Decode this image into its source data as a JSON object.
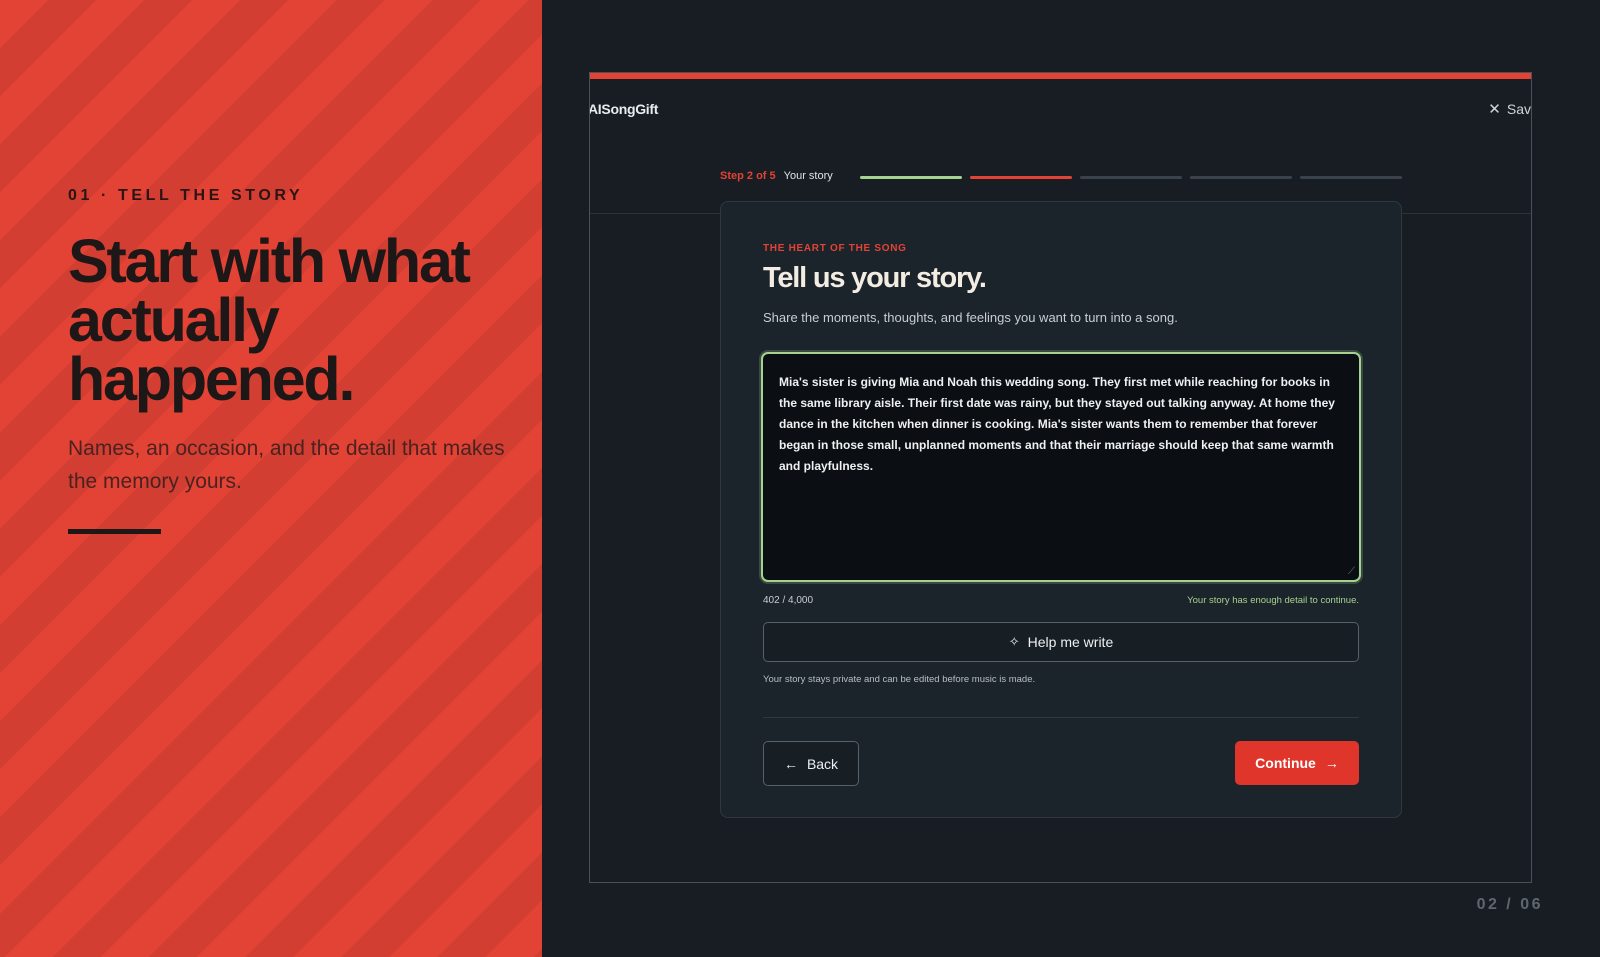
{
  "left": {
    "eyebrow": "01 · TELL THE STORY",
    "headline": "Start with what actually happened.",
    "sub": "Names, an occasion, and the detail that makes the memory yours."
  },
  "app": {
    "brand": "AISongGift",
    "save_label": "Sav",
    "close_icon": "close-icon",
    "step_count": "Step 2 of 5",
    "step_name": "Your story",
    "progress_total": 5,
    "progress_current": 2
  },
  "card": {
    "eyebrow": "THE HEART OF THE SONG",
    "title": "Tell us your story.",
    "subtitle": "Share the moments, thoughts, and feelings you want to turn into a song.",
    "story_text": "Mia's sister is giving Mia and Noah this wedding song. They first met while reaching for books in the same library aisle. Their first date was rainy, but they stayed out talking anyway. At home they dance in the kitchen when dinner is cooking. Mia's sister wants them to remember that forever began in those small, unplanned moments and that their marriage should keep that same warmth and playfulness.",
    "char_count": "402 / 4,000",
    "ready_note": "Your story has enough detail to continue.",
    "help_label": "Help me write",
    "privacy_note": "Your story stays private and can be edited before music is made.",
    "back_label": "Back",
    "continue_label": "Continue"
  },
  "slide": {
    "number": "02 / 06"
  },
  "colors": {
    "accent": "#e24335",
    "success": "#a6d28f",
    "background": "#171d23"
  }
}
